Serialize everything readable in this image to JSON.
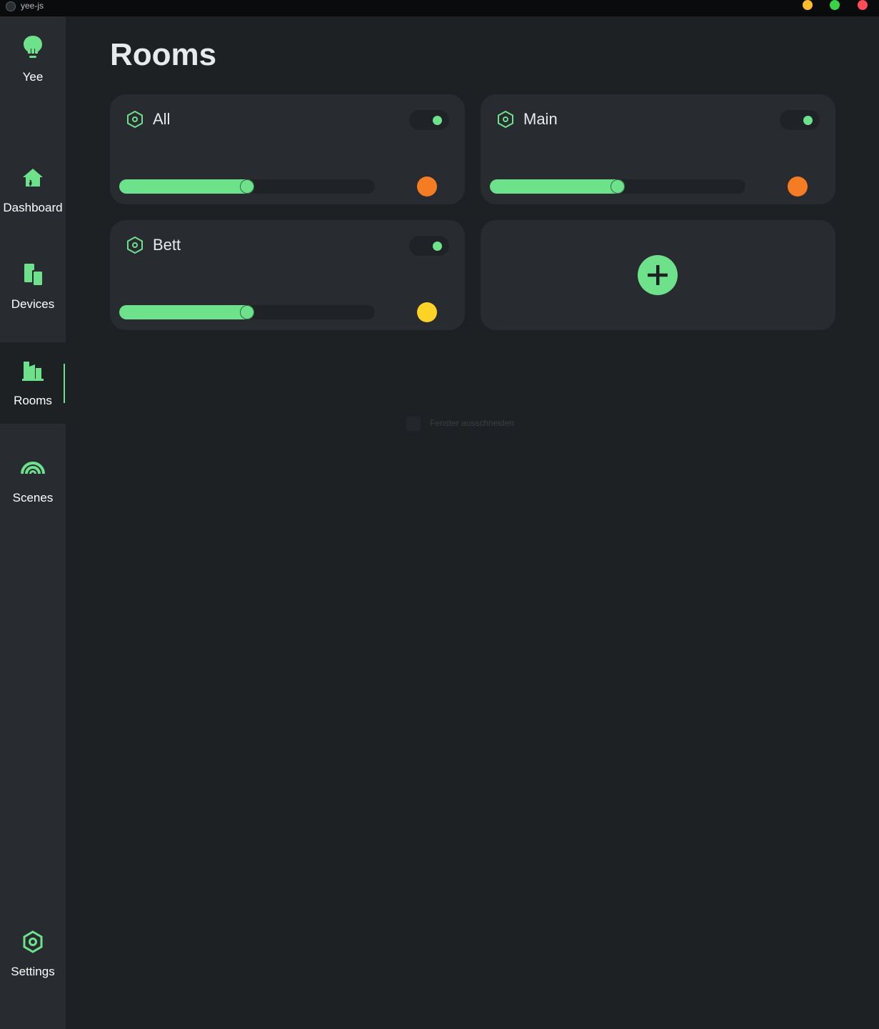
{
  "window": {
    "title": "yee-js",
    "controls": [
      "minimize",
      "maximize",
      "close"
    ]
  },
  "sidebar": {
    "brand": {
      "label": "Yee",
      "icon": "lightbulb-icon"
    },
    "items": [
      {
        "label": "Dashboard",
        "icon": "home-icon",
        "active": false
      },
      {
        "label": "Devices",
        "icon": "devices-icon",
        "active": false
      },
      {
        "label": "Rooms",
        "icon": "rooms-icon",
        "active": true
      },
      {
        "label": "Scenes",
        "icon": "rainbow-icon",
        "active": false
      }
    ],
    "settings": {
      "label": "Settings",
      "icon": "gear-icon"
    }
  },
  "page": {
    "title": "Rooms"
  },
  "rooms": [
    {
      "name": "All",
      "on": true,
      "brightness": 0.5,
      "color": "#f57c22"
    },
    {
      "name": "Main",
      "on": true,
      "brightness": 0.5,
      "color": "#f57c22"
    },
    {
      "name": "Bett",
      "on": true,
      "brightness": 0.5,
      "color": "#fdd326"
    }
  ],
  "add_room": {
    "icon": "plus-icon"
  },
  "ghost_tooltip": {
    "text": "Fenster ausschneiden"
  },
  "colors": {
    "accent": "#6de28b",
    "background": "#1e2124",
    "panel": "#282c31"
  }
}
